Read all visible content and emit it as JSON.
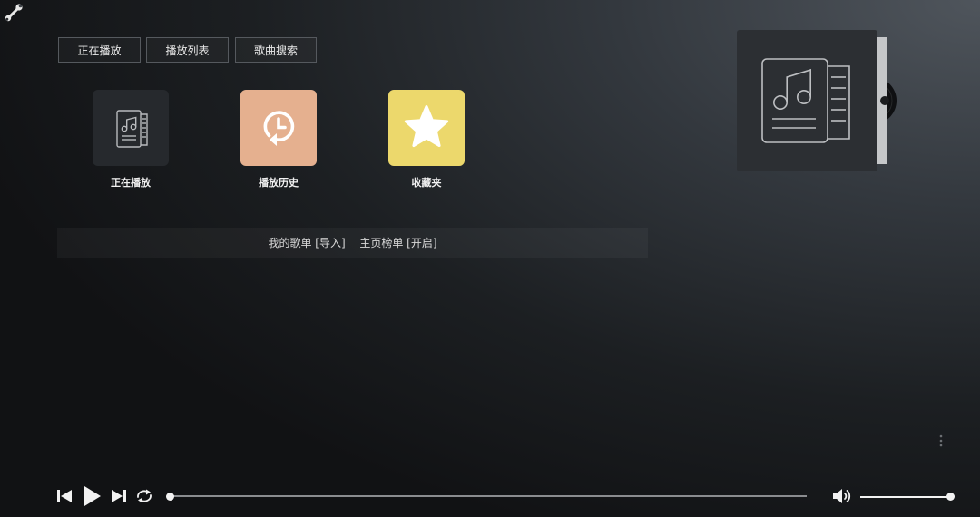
{
  "tabs": [
    {
      "label": "正在播放"
    },
    {
      "label": "播放列表"
    },
    {
      "label": "歌曲搜索"
    }
  ],
  "tiles": [
    {
      "label": "正在播放",
      "icon": "music-document-icon",
      "color": "#2a2d31"
    },
    {
      "label": "播放历史",
      "icon": "history-clock-icon",
      "color": "#e5b08f"
    },
    {
      "label": "收藏夹",
      "icon": "star-icon",
      "color": "#ecd86c"
    }
  ],
  "songbar": {
    "my_playlists": "我的歌单",
    "import": "[导入]",
    "home_chart": "主页榜单",
    "enable": "[开启]"
  },
  "player": {
    "progress": 0,
    "volume": 1.0
  },
  "icons": {
    "top_left": "wrench-icon",
    "album": "music-document-icon",
    "more": "kebab-icon"
  }
}
